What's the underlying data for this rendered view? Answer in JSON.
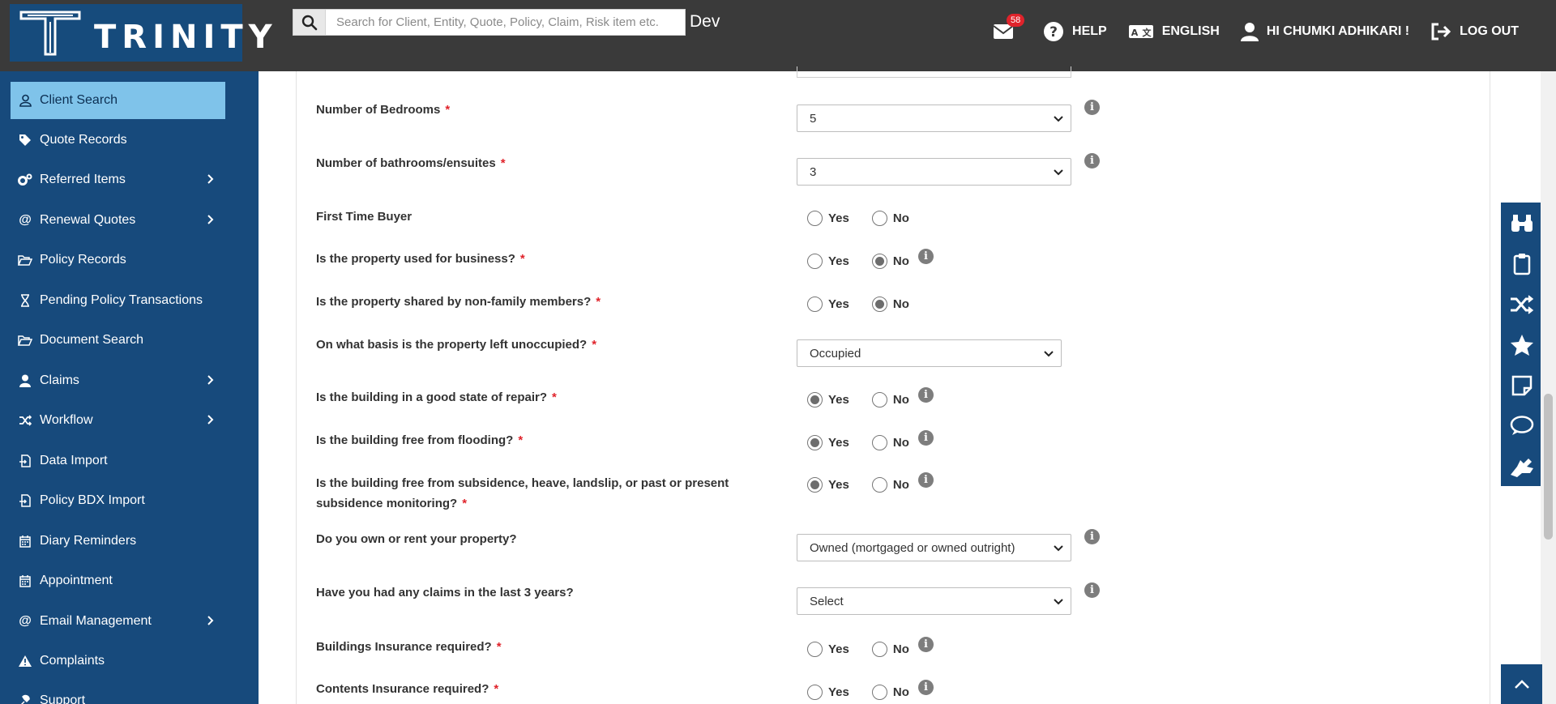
{
  "header": {
    "logo_text": "TRINITY",
    "search_placeholder": "Search for Client, Entity, Quote, Policy, Claim, Risk item etc.",
    "env": "Dev",
    "mail_count": "58",
    "help": "HELP",
    "language": "ENGLISH",
    "user_greeting": "HI CHUMKI ADHIKARI !",
    "logout": "LOG OUT"
  },
  "sidebar": {
    "items": [
      {
        "label": "Client Search",
        "icon": "user-icon",
        "active": true
      },
      {
        "label": "Quote Records",
        "icon": "tag-icon"
      },
      {
        "label": "Referred Items",
        "icon": "gears-icon",
        "submenu": true
      },
      {
        "label": "Renewal Quotes",
        "icon": "at-icon",
        "submenu": true
      },
      {
        "label": "Policy Records",
        "icon": "folder-open-icon"
      },
      {
        "label": "Pending Policy Transactions",
        "icon": "hourglass-icon"
      },
      {
        "label": "Document Search",
        "icon": "folder-open-icon"
      },
      {
        "label": "Claims",
        "icon": "user-icon",
        "submenu": true
      },
      {
        "label": "Workflow",
        "icon": "shuffle-icon",
        "submenu": true
      },
      {
        "label": "Data Import",
        "icon": "file-import-icon"
      },
      {
        "label": "Policy BDX Import",
        "icon": "file-import-icon"
      },
      {
        "label": "Diary Reminders",
        "icon": "calendar-icon"
      },
      {
        "label": "Appointment",
        "icon": "calendar-icon"
      },
      {
        "label": "Email Management",
        "icon": "at-icon",
        "submenu": true
      },
      {
        "label": "Complaints",
        "icon": "warning-icon"
      },
      {
        "label": "Support",
        "icon": "support-icon"
      }
    ]
  },
  "form": {
    "yes": "Yes",
    "no": "No",
    "required_mark": "*",
    "info_glyph": "i",
    "questions": [
      {
        "label": "Number of Bedrooms",
        "required": true,
        "type": "select",
        "value": "5"
      },
      {
        "label": "Number of bathrooms/ensuites",
        "required": true,
        "type": "select",
        "value": "3"
      },
      {
        "label": "First Time Buyer",
        "required": false,
        "type": "radio",
        "value": ""
      },
      {
        "label": "Is the property used for business?",
        "required": true,
        "type": "radio",
        "value": "No"
      },
      {
        "label": "Is the property shared by non-family members?",
        "required": true,
        "type": "radio",
        "value": "No"
      },
      {
        "label": "On what basis is the property left unoccupied?",
        "required": true,
        "type": "select",
        "value": "Occupied"
      },
      {
        "label": "Is the building in a good state of repair?",
        "required": true,
        "type": "radio",
        "value": "Yes"
      },
      {
        "label": "Is the building free from flooding?",
        "required": true,
        "type": "radio",
        "value": "Yes"
      },
      {
        "label": "Is the building free from subsidence, heave, landslip, or past or present subsidence monitoring?",
        "required": true,
        "type": "radio",
        "value": "Yes"
      },
      {
        "label": "Do you own or rent your property?",
        "required": false,
        "type": "select",
        "value": "Owned (mortgaged or owned outright)"
      },
      {
        "label": "Have you had any claims in the last 3 years?",
        "required": false,
        "type": "select",
        "value": "Select"
      },
      {
        "label": "Buildings Insurance required?",
        "required": true,
        "type": "radio",
        "value": ""
      },
      {
        "label": "Contents Insurance required?",
        "required": true,
        "type": "radio",
        "value": ""
      }
    ]
  },
  "right_toolbar": [
    "binoculars-icon",
    "clipboard-icon",
    "shuffle-icon",
    "star-icon",
    "sticky-note-icon",
    "chat-icon",
    "sign-language-icon"
  ],
  "colors": {
    "topbar": "#3a3a3a",
    "sidebar": "#174a7c",
    "active_item": "#7fc3ea",
    "required": "#e0232b"
  }
}
